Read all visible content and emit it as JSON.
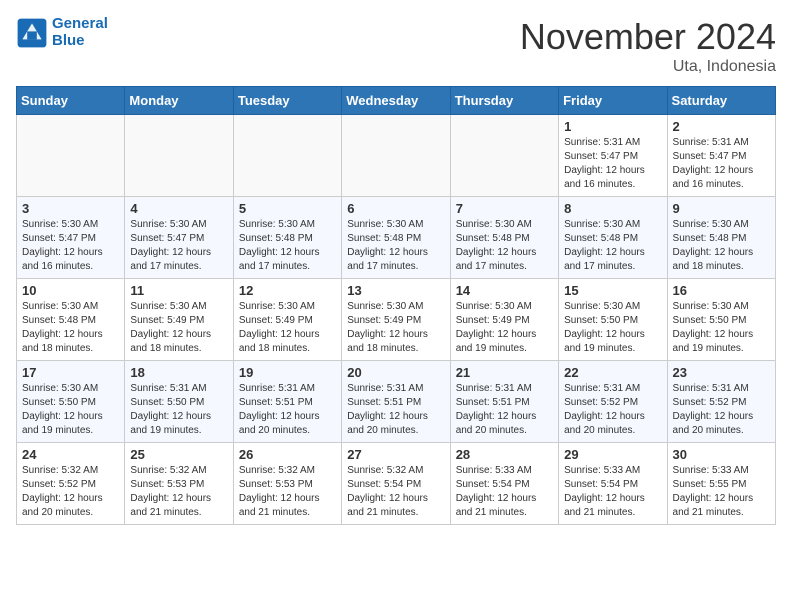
{
  "header": {
    "logo_line1": "General",
    "logo_line2": "Blue",
    "month_title": "November 2024",
    "location": "Uta, Indonesia"
  },
  "columns": [
    "Sunday",
    "Monday",
    "Tuesday",
    "Wednesday",
    "Thursday",
    "Friday",
    "Saturday"
  ],
  "weeks": [
    [
      {
        "day": "",
        "info": ""
      },
      {
        "day": "",
        "info": ""
      },
      {
        "day": "",
        "info": ""
      },
      {
        "day": "",
        "info": ""
      },
      {
        "day": "",
        "info": ""
      },
      {
        "day": "1",
        "info": "Sunrise: 5:31 AM\nSunset: 5:47 PM\nDaylight: 12 hours\nand 16 minutes."
      },
      {
        "day": "2",
        "info": "Sunrise: 5:31 AM\nSunset: 5:47 PM\nDaylight: 12 hours\nand 16 minutes."
      }
    ],
    [
      {
        "day": "3",
        "info": "Sunrise: 5:30 AM\nSunset: 5:47 PM\nDaylight: 12 hours\nand 16 minutes."
      },
      {
        "day": "4",
        "info": "Sunrise: 5:30 AM\nSunset: 5:47 PM\nDaylight: 12 hours\nand 17 minutes."
      },
      {
        "day": "5",
        "info": "Sunrise: 5:30 AM\nSunset: 5:48 PM\nDaylight: 12 hours\nand 17 minutes."
      },
      {
        "day": "6",
        "info": "Sunrise: 5:30 AM\nSunset: 5:48 PM\nDaylight: 12 hours\nand 17 minutes."
      },
      {
        "day": "7",
        "info": "Sunrise: 5:30 AM\nSunset: 5:48 PM\nDaylight: 12 hours\nand 17 minutes."
      },
      {
        "day": "8",
        "info": "Sunrise: 5:30 AM\nSunset: 5:48 PM\nDaylight: 12 hours\nand 17 minutes."
      },
      {
        "day": "9",
        "info": "Sunrise: 5:30 AM\nSunset: 5:48 PM\nDaylight: 12 hours\nand 18 minutes."
      }
    ],
    [
      {
        "day": "10",
        "info": "Sunrise: 5:30 AM\nSunset: 5:48 PM\nDaylight: 12 hours\nand 18 minutes."
      },
      {
        "day": "11",
        "info": "Sunrise: 5:30 AM\nSunset: 5:49 PM\nDaylight: 12 hours\nand 18 minutes."
      },
      {
        "day": "12",
        "info": "Sunrise: 5:30 AM\nSunset: 5:49 PM\nDaylight: 12 hours\nand 18 minutes."
      },
      {
        "day": "13",
        "info": "Sunrise: 5:30 AM\nSunset: 5:49 PM\nDaylight: 12 hours\nand 18 minutes."
      },
      {
        "day": "14",
        "info": "Sunrise: 5:30 AM\nSunset: 5:49 PM\nDaylight: 12 hours\nand 19 minutes."
      },
      {
        "day": "15",
        "info": "Sunrise: 5:30 AM\nSunset: 5:50 PM\nDaylight: 12 hours\nand 19 minutes."
      },
      {
        "day": "16",
        "info": "Sunrise: 5:30 AM\nSunset: 5:50 PM\nDaylight: 12 hours\nand 19 minutes."
      }
    ],
    [
      {
        "day": "17",
        "info": "Sunrise: 5:30 AM\nSunset: 5:50 PM\nDaylight: 12 hours\nand 19 minutes."
      },
      {
        "day": "18",
        "info": "Sunrise: 5:31 AM\nSunset: 5:50 PM\nDaylight: 12 hours\nand 19 minutes."
      },
      {
        "day": "19",
        "info": "Sunrise: 5:31 AM\nSunset: 5:51 PM\nDaylight: 12 hours\nand 20 minutes."
      },
      {
        "day": "20",
        "info": "Sunrise: 5:31 AM\nSunset: 5:51 PM\nDaylight: 12 hours\nand 20 minutes."
      },
      {
        "day": "21",
        "info": "Sunrise: 5:31 AM\nSunset: 5:51 PM\nDaylight: 12 hours\nand 20 minutes."
      },
      {
        "day": "22",
        "info": "Sunrise: 5:31 AM\nSunset: 5:52 PM\nDaylight: 12 hours\nand 20 minutes."
      },
      {
        "day": "23",
        "info": "Sunrise: 5:31 AM\nSunset: 5:52 PM\nDaylight: 12 hours\nand 20 minutes."
      }
    ],
    [
      {
        "day": "24",
        "info": "Sunrise: 5:32 AM\nSunset: 5:52 PM\nDaylight: 12 hours\nand 20 minutes."
      },
      {
        "day": "25",
        "info": "Sunrise: 5:32 AM\nSunset: 5:53 PM\nDaylight: 12 hours\nand 21 minutes."
      },
      {
        "day": "26",
        "info": "Sunrise: 5:32 AM\nSunset: 5:53 PM\nDaylight: 12 hours\nand 21 minutes."
      },
      {
        "day": "27",
        "info": "Sunrise: 5:32 AM\nSunset: 5:54 PM\nDaylight: 12 hours\nand 21 minutes."
      },
      {
        "day": "28",
        "info": "Sunrise: 5:33 AM\nSunset: 5:54 PM\nDaylight: 12 hours\nand 21 minutes."
      },
      {
        "day": "29",
        "info": "Sunrise: 5:33 AM\nSunset: 5:54 PM\nDaylight: 12 hours\nand 21 minutes."
      },
      {
        "day": "30",
        "info": "Sunrise: 5:33 AM\nSunset: 5:55 PM\nDaylight: 12 hours\nand 21 minutes."
      }
    ]
  ]
}
